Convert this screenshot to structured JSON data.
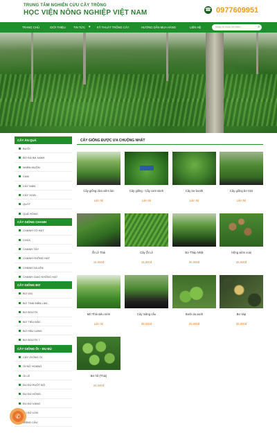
{
  "header": {
    "logo_line1": "TRUNG TÂM NGHIÊN CỨU CÂY TRỒNG",
    "logo_line2": "HỌC VIỆN NÔNG NGHIỆP VIỆT NAM",
    "phone": "0977609951",
    "phone_icon": "phone-icon"
  },
  "nav": {
    "items": [
      "TRANG CHỦ",
      "GIỚI THIỆU",
      "TIN TỨC",
      "KỸ THUẬT TRỒNG CÂY",
      "HƯỚNG DẪN MUA HÀNG",
      "LIÊN HỆ"
    ],
    "search_placeholder": "Nhập từ khóa tìm kiếm...",
    "search_icon": "search-icon"
  },
  "sidebar": {
    "groups": [
      {
        "title": "CÂY ĂN QUẢ",
        "items": [
          "BƯỞI",
          "BƠ ĐÀ BÁ XANH",
          "NHÃN MUỘN",
          "CAM",
          "CÂY MẬN",
          "CÂY XOÀI",
          "QUÝT",
          "QUẢ HỒNG"
        ]
      },
      {
        "title": "CÂY GIỐNG CHANH",
        "items": [
          "CHANH CÓ HẠT",
          "CHÚC",
          "CHANH TÂY",
          "CHANH KHÔNG HẠT",
          "CHANH DA LÊN",
          "CHANH GIAO KHÔNG HẠT"
        ]
      },
      {
        "title": "CÂY GIỐNG BƠ",
        "items": [
          "BƠ 034",
          "BƠ THÁI MÃN LAN",
          "BƠ BOOTH",
          "BƠ TIẾU ĐẶC",
          "BƠ HẬU LANG",
          "BƠ BOOTH 7"
        ]
      },
      {
        "title": "CÂY GIỐNG ỔI – ĐU ĐỦ",
        "items": [
          "CÂY GIỐNG ỔI",
          "ỔI NỮ HOÀNG",
          "ỔI LÊ",
          "ĐU ĐỦ RUỘT ĐỎ",
          "ĐU ĐỦ HỒNG",
          "ĐU ĐỦ VÀNG",
          "ĐU ĐỦ LÙN",
          "MÃNG CẦU"
        ]
      }
    ]
  },
  "main": {
    "title": "CÂY GIỐNG ĐƯỢC ƯA CHUỘNG NHẤT",
    "products": [
      {
        "name": "Cây giống dừa xiêm lùn",
        "price": "Liên hệ"
      },
      {
        "name": "Cây giống - Cây cam sành",
        "price": "Liên hệ"
      },
      {
        "name": "Cây bơ booth",
        "price": "Liên hệ"
      },
      {
        "name": "Cây giống bơ 034",
        "price": "Liên hệ"
      },
      {
        "name": "Ổi Lê Thái",
        "price": "15.000đ"
      },
      {
        "name": "Cây Ổi Lê",
        "price": "15.000đ"
      },
      {
        "name": "Bơ Tháp Nhật",
        "price": "35.000đ"
      },
      {
        "name": "Hồng xiêm xoài",
        "price": "35.000đ"
      },
      {
        "name": "Mít Thái siêu sớm",
        "price": "Liên hệ"
      },
      {
        "name": "Cây mãng cầu",
        "price": "35.000đ"
      },
      {
        "name": "Bưởi da xanh",
        "price": "25.000đ"
      },
      {
        "name": "Bơ sáp",
        "price": "35.000đ"
      },
      {
        "name": "Bơ hồ (Thái)",
        "price": "25.000đ"
      }
    ]
  },
  "call_button": {
    "icon": "phone-icon",
    "color": "#e8742a"
  },
  "colors": {
    "brand_green": "#1e8f2a",
    "phone_orange": "#f39c12",
    "price_orange": "#e67e22"
  }
}
